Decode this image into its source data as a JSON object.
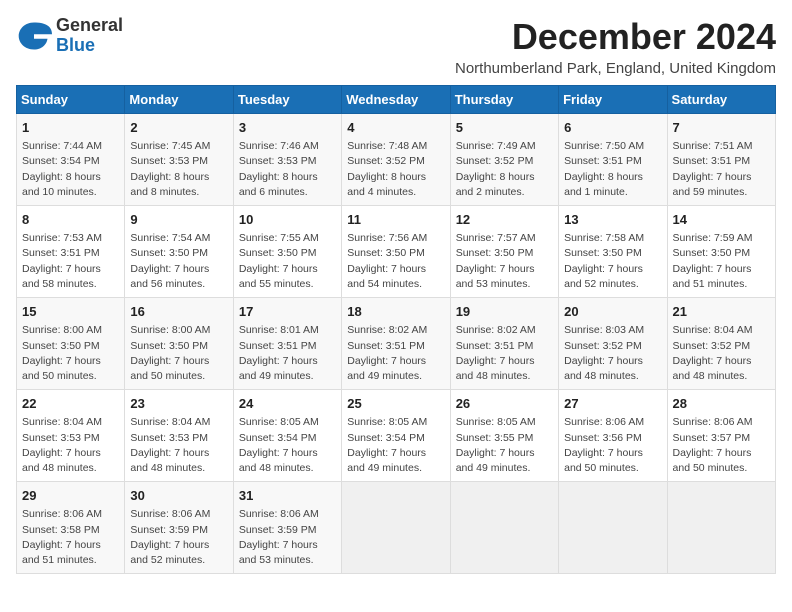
{
  "header": {
    "logo_general": "General",
    "logo_blue": "Blue",
    "month_title": "December 2024",
    "location": "Northumberland Park, England, United Kingdom"
  },
  "calendar": {
    "days_of_week": [
      "Sunday",
      "Monday",
      "Tuesday",
      "Wednesday",
      "Thursday",
      "Friday",
      "Saturday"
    ],
    "weeks": [
      [
        null,
        {
          "day": "2",
          "sunrise": "7:45 AM",
          "sunset": "3:53 PM",
          "daylight": "8 hours and 8 minutes."
        },
        {
          "day": "3",
          "sunrise": "7:46 AM",
          "sunset": "3:53 PM",
          "daylight": "8 hours and 6 minutes."
        },
        {
          "day": "4",
          "sunrise": "7:48 AM",
          "sunset": "3:52 PM",
          "daylight": "8 hours and 4 minutes."
        },
        {
          "day": "5",
          "sunrise": "7:49 AM",
          "sunset": "3:52 PM",
          "daylight": "8 hours and 2 minutes."
        },
        {
          "day": "6",
          "sunrise": "7:50 AM",
          "sunset": "3:51 PM",
          "daylight": "8 hours and 1 minute."
        },
        {
          "day": "7",
          "sunrise": "7:51 AM",
          "sunset": "3:51 PM",
          "daylight": "7 hours and 59 minutes."
        }
      ],
      [
        {
          "day": "1",
          "sunrise": "7:44 AM",
          "sunset": "3:54 PM",
          "daylight": "8 hours and 10 minutes."
        },
        null,
        null,
        null,
        null,
        null,
        null
      ],
      [
        {
          "day": "8",
          "sunrise": "7:53 AM",
          "sunset": "3:51 PM",
          "daylight": "7 hours and 58 minutes."
        },
        {
          "day": "9",
          "sunrise": "7:54 AM",
          "sunset": "3:50 PM",
          "daylight": "7 hours and 56 minutes."
        },
        {
          "day": "10",
          "sunrise": "7:55 AM",
          "sunset": "3:50 PM",
          "daylight": "7 hours and 55 minutes."
        },
        {
          "day": "11",
          "sunrise": "7:56 AM",
          "sunset": "3:50 PM",
          "daylight": "7 hours and 54 minutes."
        },
        {
          "day": "12",
          "sunrise": "7:57 AM",
          "sunset": "3:50 PM",
          "daylight": "7 hours and 53 minutes."
        },
        {
          "day": "13",
          "sunrise": "7:58 AM",
          "sunset": "3:50 PM",
          "daylight": "7 hours and 52 minutes."
        },
        {
          "day": "14",
          "sunrise": "7:59 AM",
          "sunset": "3:50 PM",
          "daylight": "7 hours and 51 minutes."
        }
      ],
      [
        {
          "day": "15",
          "sunrise": "8:00 AM",
          "sunset": "3:50 PM",
          "daylight": "7 hours and 50 minutes."
        },
        {
          "day": "16",
          "sunrise": "8:00 AM",
          "sunset": "3:50 PM",
          "daylight": "7 hours and 50 minutes."
        },
        {
          "day": "17",
          "sunrise": "8:01 AM",
          "sunset": "3:51 PM",
          "daylight": "7 hours and 49 minutes."
        },
        {
          "day": "18",
          "sunrise": "8:02 AM",
          "sunset": "3:51 PM",
          "daylight": "7 hours and 49 minutes."
        },
        {
          "day": "19",
          "sunrise": "8:02 AM",
          "sunset": "3:51 PM",
          "daylight": "7 hours and 48 minutes."
        },
        {
          "day": "20",
          "sunrise": "8:03 AM",
          "sunset": "3:52 PM",
          "daylight": "7 hours and 48 minutes."
        },
        {
          "day": "21",
          "sunrise": "8:04 AM",
          "sunset": "3:52 PM",
          "daylight": "7 hours and 48 minutes."
        }
      ],
      [
        {
          "day": "22",
          "sunrise": "8:04 AM",
          "sunset": "3:53 PM",
          "daylight": "7 hours and 48 minutes."
        },
        {
          "day": "23",
          "sunrise": "8:04 AM",
          "sunset": "3:53 PM",
          "daylight": "7 hours and 48 minutes."
        },
        {
          "day": "24",
          "sunrise": "8:05 AM",
          "sunset": "3:54 PM",
          "daylight": "7 hours and 48 minutes."
        },
        {
          "day": "25",
          "sunrise": "8:05 AM",
          "sunset": "3:54 PM",
          "daylight": "7 hours and 49 minutes."
        },
        {
          "day": "26",
          "sunrise": "8:05 AM",
          "sunset": "3:55 PM",
          "daylight": "7 hours and 49 minutes."
        },
        {
          "day": "27",
          "sunrise": "8:06 AM",
          "sunset": "3:56 PM",
          "daylight": "7 hours and 50 minutes."
        },
        {
          "day": "28",
          "sunrise": "8:06 AM",
          "sunset": "3:57 PM",
          "daylight": "7 hours and 50 minutes."
        }
      ],
      [
        {
          "day": "29",
          "sunrise": "8:06 AM",
          "sunset": "3:58 PM",
          "daylight": "7 hours and 51 minutes."
        },
        {
          "day": "30",
          "sunrise": "8:06 AM",
          "sunset": "3:59 PM",
          "daylight": "7 hours and 52 minutes."
        },
        {
          "day": "31",
          "sunrise": "8:06 AM",
          "sunset": "3:59 PM",
          "daylight": "7 hours and 53 minutes."
        },
        null,
        null,
        null,
        null
      ]
    ]
  }
}
